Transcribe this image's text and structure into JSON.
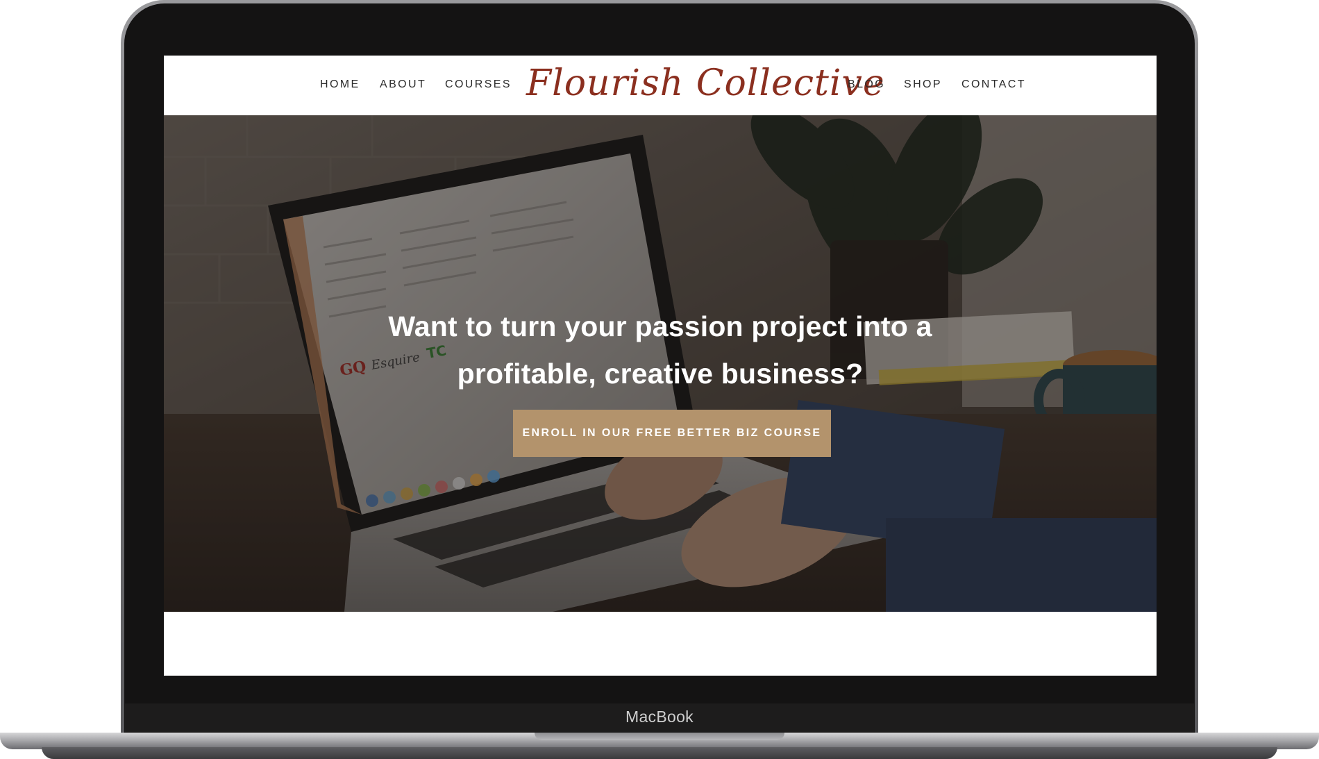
{
  "device": {
    "brand_label": "MacBook"
  },
  "header": {
    "nav_left": [
      "HOME",
      "ABOUT",
      "COURSES"
    ],
    "logo_text": "Flourish Collective",
    "nav_right": [
      "BLOG",
      "SHOP",
      "CONTACT"
    ]
  },
  "hero": {
    "headline_line1": "Want to turn your passion project into a",
    "headline_line2": "profitable, creative business?",
    "cta_label": "ENROLL IN OUR FREE BETTER BIZ COURSE"
  },
  "colors": {
    "logo": "#8b2f1f",
    "cta_background": "#b3936c",
    "nav_text": "#2b2b2b",
    "bezel": "#141313"
  }
}
